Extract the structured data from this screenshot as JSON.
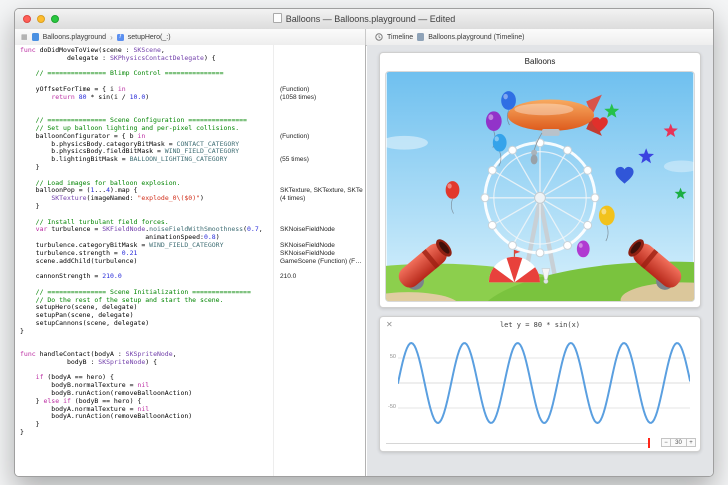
{
  "window": {
    "title": "Balloons — Balloons.playground — Edited"
  },
  "jumpbar": {
    "left_items": [
      {
        "label": "Balloons.playground"
      },
      {
        "label": "setupHero(_:)"
      }
    ],
    "right_items": [
      {
        "label": "Timeline"
      },
      {
        "label": "Balloons.playground (Timeline)"
      }
    ]
  },
  "editor": {
    "code_lines": [
      [
        [
          "k",
          "func"
        ],
        [
          "p",
          " doDidMoveToView(scene : "
        ],
        [
          "t",
          "SKScene"
        ],
        [
          "p",
          ","
        ]
      ],
      [
        [
          "p",
          "            delegate : "
        ],
        [
          "t",
          "SKPhysicsContactDelegate"
        ],
        [
          "p",
          ") {"
        ]
      ],
      [],
      [
        [
          "c",
          "    // =============== Blimp Control ==============="
        ]
      ],
      [],
      [
        [
          "p",
          "    yOffsetForTime = { i "
        ],
        [
          "k",
          "in"
        ]
      ],
      [
        [
          "p",
          "        "
        ],
        [
          "k",
          "return"
        ],
        [
          "p",
          " "
        ],
        [
          "n",
          "80"
        ],
        [
          "p",
          " * sin(i / "
        ],
        [
          "n",
          "10.0"
        ],
        [
          "p",
          ")"
        ]
      ],
      [],
      [],
      [
        [
          "c",
          "    // =============== Scene Configuration ==============="
        ]
      ],
      [
        [
          "c",
          "    // Set up balloon lighting and per-pixel collisions."
        ]
      ],
      [
        [
          "p",
          "    balloonConfigurator = { b "
        ],
        [
          "k",
          "in"
        ]
      ],
      [
        [
          "p",
          "        b.physicsBody.categoryBitMask = "
        ],
        [
          "m",
          "CONTACT_CATEGORY"
        ]
      ],
      [
        [
          "p",
          "        b.physicsBody.fieldBitMask = "
        ],
        [
          "m",
          "WIND_FIELD_CATEGORY"
        ]
      ],
      [
        [
          "p",
          "        b.lightingBitMask = "
        ],
        [
          "m",
          "BALLOON_LIGHTING_CATEGORY"
        ]
      ],
      [
        [
          "p",
          "    }"
        ]
      ],
      [],
      [
        [
          "c",
          "    // Load images for balloon explosion."
        ]
      ],
      [
        [
          "p",
          "    balloonPop = ("
        ],
        [
          "n",
          "1"
        ],
        [
          "p",
          "..."
        ],
        [
          "n",
          "4"
        ],
        [
          "p",
          ").map {"
        ]
      ],
      [
        [
          "p",
          "        "
        ],
        [
          "t",
          "SKTexture"
        ],
        [
          "p",
          "(imageNamed: "
        ],
        [
          "s",
          "\"explode_0\\($0)\""
        ],
        [
          "p",
          ")"
        ]
      ],
      [
        [
          "p",
          "    }"
        ]
      ],
      [],
      [
        [
          "c",
          "    // Install turbulant field forces."
        ]
      ],
      [
        [
          "p",
          "    "
        ],
        [
          "k",
          "var"
        ],
        [
          "p",
          " turbulence = "
        ],
        [
          "t",
          "SKFieldNode"
        ],
        [
          "p",
          "."
        ],
        [
          "m",
          "noiseFieldWithSmoothness"
        ],
        [
          "p",
          "("
        ],
        [
          "n",
          "0.7"
        ],
        [
          "p",
          ","
        ]
      ],
      [
        [
          "p",
          "                                animationSpeed:"
        ],
        [
          "n",
          "0.8"
        ],
        [
          "p",
          ")"
        ]
      ],
      [
        [
          "p",
          "    turbulence.categoryBitMask = "
        ],
        [
          "m",
          "WIND_FIELD_CATEGORY"
        ]
      ],
      [
        [
          "p",
          "    turbulence.strength = "
        ],
        [
          "n",
          "0.21"
        ]
      ],
      [
        [
          "p",
          "    scene.addChild(turbulence)"
        ]
      ],
      [],
      [
        [
          "p",
          "    cannonStrength = "
        ],
        [
          "n",
          "210.0"
        ]
      ],
      [],
      [
        [
          "c",
          "    // =============== Scene Initialization ==============="
        ]
      ],
      [
        [
          "c",
          "    // Do the rest of the setup and start the scene."
        ]
      ],
      [
        [
          "p",
          "    setupHero(scene, delegate)"
        ]
      ],
      [
        [
          "p",
          "    setupPan(scene, delegate)"
        ]
      ],
      [
        [
          "p",
          "    setupCannons(scene, delegate)"
        ]
      ],
      [
        [
          "p",
          "}"
        ]
      ],
      [],
      [],
      [
        [
          "k",
          "func"
        ],
        [
          "p",
          " handleContact(bodyA : "
        ],
        [
          "t",
          "SKSpriteNode"
        ],
        [
          "p",
          ","
        ]
      ],
      [
        [
          "p",
          "            bodyB : "
        ],
        [
          "t",
          "SKSpriteNode"
        ],
        [
          "p",
          ") {"
        ]
      ],
      [],
      [
        [
          "p",
          "    "
        ],
        [
          "k",
          "if"
        ],
        [
          "p",
          " (bodyA == hero) {"
        ]
      ],
      [
        [
          "p",
          "        bodyB.normalTexture = "
        ],
        [
          "k",
          "nil"
        ]
      ],
      [
        [
          "p",
          "        bodyB.runAction(removeBalloonAction)"
        ]
      ],
      [
        [
          "p",
          "    } "
        ],
        [
          "k",
          "else"
        ],
        [
          "p",
          " "
        ],
        [
          "k",
          "if"
        ],
        [
          "p",
          " (bodyB == hero) {"
        ]
      ],
      [
        [
          "p",
          "        bodyA.normalTexture = "
        ],
        [
          "k",
          "nil"
        ]
      ],
      [
        [
          "p",
          "        bodyA.runAction(removeBalloonAction)"
        ]
      ],
      [
        [
          "p",
          "    }"
        ]
      ],
      [
        [
          "p",
          "}"
        ]
      ]
    ],
    "results": [
      {
        "line": 5,
        "text": "(Function)"
      },
      {
        "line": 6,
        "text": "(1058 times)"
      },
      {
        "line": 11,
        "text": "(Function)"
      },
      {
        "line": 14,
        "text": "(55 times)"
      },
      {
        "line": 18,
        "text": "SKTexture, SKTexture, SKTe…"
      },
      {
        "line": 19,
        "text": "(4 times)"
      },
      {
        "line": 23,
        "text": "SKNoiseFieldNode"
      },
      {
        "line": 25,
        "text": "SKNoiseFieldNode"
      },
      {
        "line": 26,
        "text": "SKNoiseFieldNode"
      },
      {
        "line": 27,
        "text": "GameScene (Function) (F…"
      },
      {
        "line": 29,
        "text": "210.0"
      }
    ]
  },
  "timeline": {
    "scene_title": "Balloons",
    "scrubber": {
      "value": "30"
    }
  },
  "chart_data": {
    "type": "line",
    "title": "let y = 80 * sin(x)",
    "expression": "y = 80 * sin(x)",
    "amplitude": 80,
    "x_range": [
      0,
      34.5
    ],
    "y_ticks": [
      "50",
      "-50"
    ],
    "ylim": [
      -100,
      100
    ],
    "grid": true,
    "legend": "none",
    "line_color": "#5a9fe0",
    "playhead_color": "#ff2619"
  }
}
